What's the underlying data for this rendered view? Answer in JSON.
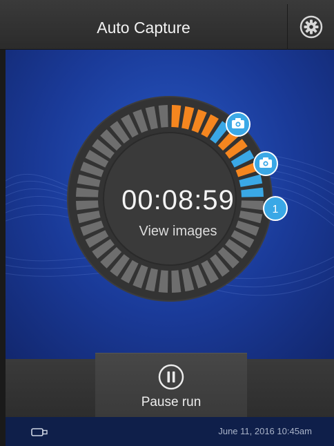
{
  "header": {
    "title": "Auto Capture",
    "settings_icon": "gear-icon"
  },
  "timer": {
    "elapsed": "00:08:59",
    "view_images_label": "View images"
  },
  "markers": [
    {
      "icon": "camera-icon"
    },
    {
      "icon": "camera-icon"
    },
    {
      "icon": "count-badge",
      "label": "1"
    }
  ],
  "bottom_bar": {
    "pause_label": "Pause run",
    "pause_icon": "pause-icon"
  },
  "status_bar": {
    "device_icon": "usb-drive-icon",
    "datetime": "June 11, 2016 10:45am"
  },
  "colors": {
    "accent_orange": "#f5861f",
    "accent_blue": "#3aa8e6",
    "segment_gray": "#6e6e6e",
    "background_blue": "#1a3a98"
  }
}
